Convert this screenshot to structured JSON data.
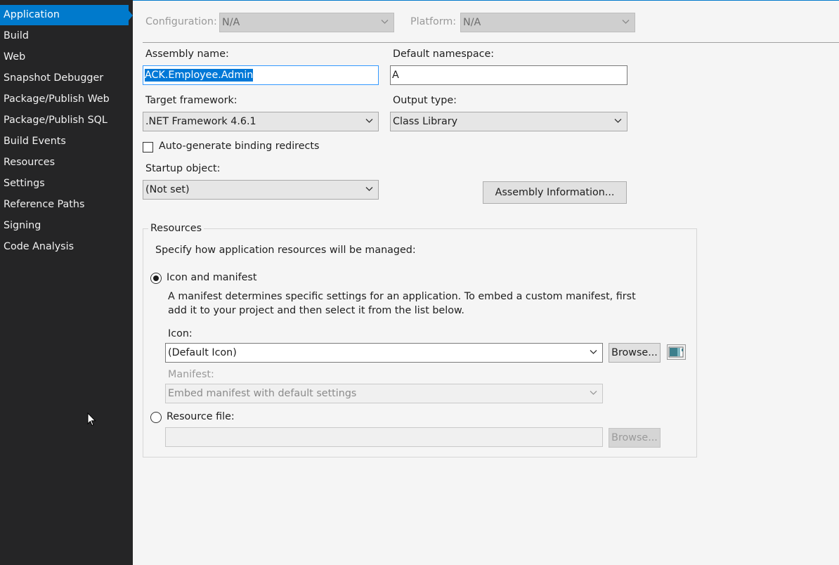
{
  "sidebar": {
    "items": [
      {
        "label": "Application",
        "active": true
      },
      {
        "label": "Build"
      },
      {
        "label": "Web"
      },
      {
        "label": "Snapshot Debugger"
      },
      {
        "label": "Package/Publish Web"
      },
      {
        "label": "Package/Publish SQL"
      },
      {
        "label": "Build Events"
      },
      {
        "label": "Resources"
      },
      {
        "label": "Settings"
      },
      {
        "label": "Reference Paths"
      },
      {
        "label": "Signing"
      },
      {
        "label": "Code Analysis"
      }
    ]
  },
  "config": {
    "configuration_label": "Configuration:",
    "configuration_value": "N/A",
    "platform_label": "Platform:",
    "platform_value": "N/A"
  },
  "assembly": {
    "assembly_name_label": "Assembly name:",
    "assembly_name_value": "ACK.Employee.Admin",
    "default_namespace_label": "Default namespace:",
    "default_namespace_value": "A",
    "target_framework_label": "Target framework:",
    "target_framework_value": ".NET Framework 4.6.1",
    "output_type_label": "Output type:",
    "output_type_value": "Class Library",
    "auto_binding_label": "Auto-generate binding redirects",
    "auto_binding_checked": false,
    "startup_object_label": "Startup object:",
    "startup_object_value": "(Not set)",
    "assembly_info_button": "Assembly Information..."
  },
  "resources": {
    "group_title": "Resources",
    "description": "Specify how application resources will be managed:",
    "icon_manifest_label": "Icon and manifest",
    "icon_manifest_selected": true,
    "manifest_help_line1": "A manifest determines specific settings for an application. To embed a custom manifest, first",
    "manifest_help_line2": "add it to your project and then select it from the list below.",
    "icon_label": "Icon:",
    "icon_value": "(Default Icon)",
    "browse_label": "Browse...",
    "manifest_label": "Manifest:",
    "manifest_value": "Embed manifest with default settings",
    "resource_file_label": "Resource file:",
    "resource_file_selected": false,
    "resource_file_value": "",
    "browse2_label": "Browse..."
  },
  "colors": {
    "sidebar_bg": "#252526",
    "accent": "#007acc",
    "content_bg": "#f5f5f5"
  }
}
